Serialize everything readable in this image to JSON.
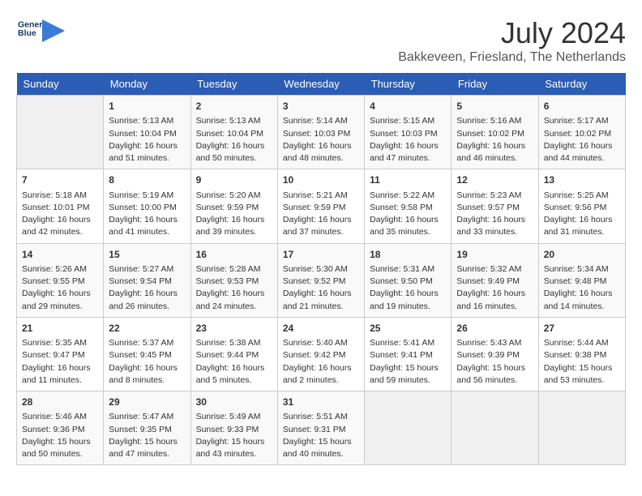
{
  "logo": {
    "line1": "General",
    "line2": "Blue"
  },
  "title": "July 2024",
  "location": "Bakkeveen, Friesland, The Netherlands",
  "days_of_week": [
    "Sunday",
    "Monday",
    "Tuesday",
    "Wednesday",
    "Thursday",
    "Friday",
    "Saturday"
  ],
  "weeks": [
    [
      {
        "day": "",
        "content": ""
      },
      {
        "day": "1",
        "content": "Sunrise: 5:13 AM\nSunset: 10:04 PM\nDaylight: 16 hours\nand 51 minutes."
      },
      {
        "day": "2",
        "content": "Sunrise: 5:13 AM\nSunset: 10:04 PM\nDaylight: 16 hours\nand 50 minutes."
      },
      {
        "day": "3",
        "content": "Sunrise: 5:14 AM\nSunset: 10:03 PM\nDaylight: 16 hours\nand 48 minutes."
      },
      {
        "day": "4",
        "content": "Sunrise: 5:15 AM\nSunset: 10:03 PM\nDaylight: 16 hours\nand 47 minutes."
      },
      {
        "day": "5",
        "content": "Sunrise: 5:16 AM\nSunset: 10:02 PM\nDaylight: 16 hours\nand 46 minutes."
      },
      {
        "day": "6",
        "content": "Sunrise: 5:17 AM\nSunset: 10:02 PM\nDaylight: 16 hours\nand 44 minutes."
      }
    ],
    [
      {
        "day": "7",
        "content": "Sunrise: 5:18 AM\nSunset: 10:01 PM\nDaylight: 16 hours\nand 42 minutes."
      },
      {
        "day": "8",
        "content": "Sunrise: 5:19 AM\nSunset: 10:00 PM\nDaylight: 16 hours\nand 41 minutes."
      },
      {
        "day": "9",
        "content": "Sunrise: 5:20 AM\nSunset: 9:59 PM\nDaylight: 16 hours\nand 39 minutes."
      },
      {
        "day": "10",
        "content": "Sunrise: 5:21 AM\nSunset: 9:59 PM\nDaylight: 16 hours\nand 37 minutes."
      },
      {
        "day": "11",
        "content": "Sunrise: 5:22 AM\nSunset: 9:58 PM\nDaylight: 16 hours\nand 35 minutes."
      },
      {
        "day": "12",
        "content": "Sunrise: 5:23 AM\nSunset: 9:57 PM\nDaylight: 16 hours\nand 33 minutes."
      },
      {
        "day": "13",
        "content": "Sunrise: 5:25 AM\nSunset: 9:56 PM\nDaylight: 16 hours\nand 31 minutes."
      }
    ],
    [
      {
        "day": "14",
        "content": "Sunrise: 5:26 AM\nSunset: 9:55 PM\nDaylight: 16 hours\nand 29 minutes."
      },
      {
        "day": "15",
        "content": "Sunrise: 5:27 AM\nSunset: 9:54 PM\nDaylight: 16 hours\nand 26 minutes."
      },
      {
        "day": "16",
        "content": "Sunrise: 5:28 AM\nSunset: 9:53 PM\nDaylight: 16 hours\nand 24 minutes."
      },
      {
        "day": "17",
        "content": "Sunrise: 5:30 AM\nSunset: 9:52 PM\nDaylight: 16 hours\nand 21 minutes."
      },
      {
        "day": "18",
        "content": "Sunrise: 5:31 AM\nSunset: 9:50 PM\nDaylight: 16 hours\nand 19 minutes."
      },
      {
        "day": "19",
        "content": "Sunrise: 5:32 AM\nSunset: 9:49 PM\nDaylight: 16 hours\nand 16 minutes."
      },
      {
        "day": "20",
        "content": "Sunrise: 5:34 AM\nSunset: 9:48 PM\nDaylight: 16 hours\nand 14 minutes."
      }
    ],
    [
      {
        "day": "21",
        "content": "Sunrise: 5:35 AM\nSunset: 9:47 PM\nDaylight: 16 hours\nand 11 minutes."
      },
      {
        "day": "22",
        "content": "Sunrise: 5:37 AM\nSunset: 9:45 PM\nDaylight: 16 hours\nand 8 minutes."
      },
      {
        "day": "23",
        "content": "Sunrise: 5:38 AM\nSunset: 9:44 PM\nDaylight: 16 hours\nand 5 minutes."
      },
      {
        "day": "24",
        "content": "Sunrise: 5:40 AM\nSunset: 9:42 PM\nDaylight: 16 hours\nand 2 minutes."
      },
      {
        "day": "25",
        "content": "Sunrise: 5:41 AM\nSunset: 9:41 PM\nDaylight: 15 hours\nand 59 minutes."
      },
      {
        "day": "26",
        "content": "Sunrise: 5:43 AM\nSunset: 9:39 PM\nDaylight: 15 hours\nand 56 minutes."
      },
      {
        "day": "27",
        "content": "Sunrise: 5:44 AM\nSunset: 9:38 PM\nDaylight: 15 hours\nand 53 minutes."
      }
    ],
    [
      {
        "day": "28",
        "content": "Sunrise: 5:46 AM\nSunset: 9:36 PM\nDaylight: 15 hours\nand 50 minutes."
      },
      {
        "day": "29",
        "content": "Sunrise: 5:47 AM\nSunset: 9:35 PM\nDaylight: 15 hours\nand 47 minutes."
      },
      {
        "day": "30",
        "content": "Sunrise: 5:49 AM\nSunset: 9:33 PM\nDaylight: 15 hours\nand 43 minutes."
      },
      {
        "day": "31",
        "content": "Sunrise: 5:51 AM\nSunset: 9:31 PM\nDaylight: 15 hours\nand 40 minutes."
      },
      {
        "day": "",
        "content": ""
      },
      {
        "day": "",
        "content": ""
      },
      {
        "day": "",
        "content": ""
      }
    ]
  ]
}
